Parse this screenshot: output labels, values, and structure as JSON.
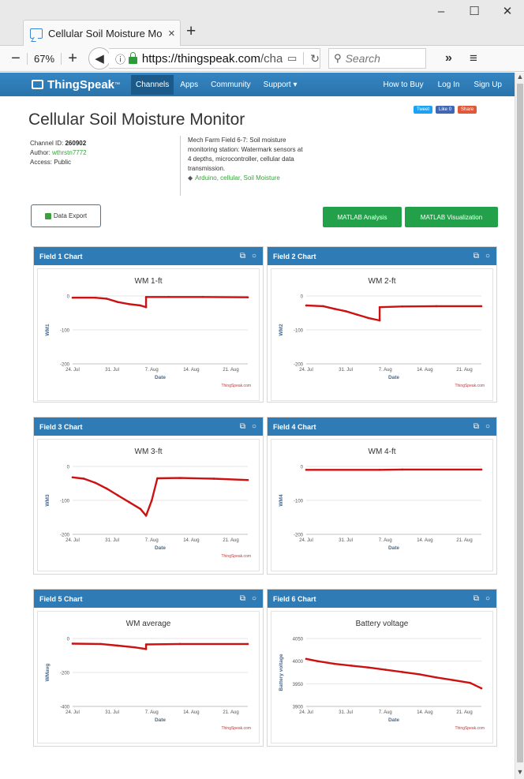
{
  "browser": {
    "tab_title": "Cellular Soil Moisture Mo",
    "tab_close": "×",
    "new_tab": "+",
    "window_minimize": "–",
    "window_maximize": "☐",
    "window_close": "✕",
    "zoom_minus": "−",
    "zoom_level": "67%",
    "zoom_plus": "+",
    "url_host": "https://thingspeak.com",
    "url_path": "/cha",
    "search_placeholder": "Search",
    "overflow_glyph": "»",
    "menu_glyph": "≡"
  },
  "site_nav": {
    "logo": "ThingSpeak",
    "logo_tm": "™",
    "items": [
      "Channels",
      "Apps",
      "Community",
      "Support ▾"
    ],
    "right_items": [
      "How to Buy",
      "Log In",
      "Sign Up"
    ]
  },
  "social": {
    "tweet": "Tweet",
    "like": "Like 0",
    "share": "Share"
  },
  "channel": {
    "title": "Cellular Soil Moisture Monitor",
    "id_label": "Channel ID:",
    "id_value": "260902",
    "author_label": "Author:",
    "author_value": "wthrstn7772",
    "access": "Access: Public",
    "description_lines": [
      "Mech Farm Field 6-7: Soil moisture",
      "monitoring station: Watermark sensors at",
      "4 depths, microcontroller, cellular data",
      "transmission."
    ],
    "tags": "Arduino, cellular, Soil Moisture"
  },
  "buttons": {
    "data_export": "Data Export",
    "matlab_analysis": "MATLAB Analysis",
    "matlab_visualization": "MATLAB Visualization"
  },
  "colors": {
    "nav_blue": "#2e7bb6",
    "series_red": "#cc1111",
    "button_green": "#22a14a",
    "link_green": "#37a33a"
  },
  "chart_data": [
    {
      "panel": "Field 1 Chart",
      "type": "line",
      "title": "WM 1-ft",
      "xlabel": "Date",
      "ylabel": "WM1",
      "credit": "ThingSpeak.com",
      "x_ticks": [
        "24. Jul",
        "31. Jul",
        "7. Aug",
        "14. Aug",
        "21. Aug"
      ],
      "xlim": [
        "2017-07-24",
        "2017-08-24"
      ],
      "y_ticks": [
        0,
        -100,
        -200
      ],
      "ylim": [
        -200,
        0
      ],
      "x": [
        "2017-07-24",
        "2017-07-28",
        "2017-07-30",
        "2017-08-01",
        "2017-08-03",
        "2017-08-05",
        "2017-08-06",
        "2017-08-06",
        "2017-08-10",
        "2017-08-16",
        "2017-08-24"
      ],
      "values": [
        -5,
        -5,
        -8,
        -18,
        -24,
        -28,
        -33,
        -3,
        -3,
        -3,
        -4
      ]
    },
    {
      "panel": "Field 2 Chart",
      "type": "line",
      "title": "WM 2-ft",
      "xlabel": "Date",
      "ylabel": "WM2",
      "credit": "ThingSpeak.com",
      "x_ticks": [
        "24. Jul",
        "31. Jul",
        "7. Aug",
        "14. Aug",
        "21. Aug"
      ],
      "xlim": [
        "2017-07-24",
        "2017-08-24"
      ],
      "y_ticks": [
        0,
        -100,
        -200
      ],
      "ylim": [
        -200,
        0
      ],
      "x": [
        "2017-07-24",
        "2017-07-27",
        "2017-07-29",
        "2017-07-31",
        "2017-08-02",
        "2017-08-04",
        "2017-08-06",
        "2017-08-06",
        "2017-08-10",
        "2017-08-16",
        "2017-08-24"
      ],
      "values": [
        -28,
        -30,
        -38,
        -45,
        -55,
        -65,
        -72,
        -33,
        -31,
        -30,
        -30
      ]
    },
    {
      "panel": "Field 3 Chart",
      "type": "line",
      "title": "WM 3-ft",
      "xlabel": "Date",
      "ylabel": "WM3",
      "credit": "ThingSpeak.com",
      "x_ticks": [
        "24. Jul",
        "31. Jul",
        "7. Aug",
        "14. Aug",
        "21. Aug"
      ],
      "xlim": [
        "2017-07-24",
        "2017-08-24"
      ],
      "y_ticks": [
        0,
        -100,
        -200
      ],
      "ylim": [
        -200,
        0
      ],
      "x": [
        "2017-07-24",
        "2017-07-26",
        "2017-07-28",
        "2017-07-30",
        "2017-08-01",
        "2017-08-03",
        "2017-08-05",
        "2017-08-06",
        "2017-08-07",
        "2017-08-08",
        "2017-08-12",
        "2017-08-18",
        "2017-08-24"
      ],
      "values": [
        -32,
        -36,
        -48,
        -65,
        -85,
        -105,
        -125,
        -145,
        -100,
        -35,
        -34,
        -36,
        -40
      ]
    },
    {
      "panel": "Field 4 Chart",
      "type": "line",
      "title": "WM 4-ft",
      "xlabel": "Date",
      "ylabel": "WM4",
      "credit": "",
      "x_ticks": [
        "24. Jul",
        "31. Jul",
        "7. Aug",
        "14. Aug",
        "21. Aug"
      ],
      "xlim": [
        "2017-07-24",
        "2017-08-24"
      ],
      "y_ticks": [
        0,
        -100,
        -200
      ],
      "ylim": [
        -200,
        0
      ],
      "x": [
        "2017-07-24",
        "2017-08-06",
        "2017-08-10",
        "2017-08-24"
      ],
      "values": [
        -10,
        -10,
        -9,
        -9
      ]
    },
    {
      "panel": "Field 5 Chart",
      "type": "line",
      "title": "WM average",
      "xlabel": "Date",
      "ylabel": "WMavg",
      "credit": "ThingSpeak.com",
      "x_ticks": [
        "24. Jul",
        "31. Jul",
        "7. Aug",
        "14. Aug",
        "21. Aug"
      ],
      "xlim": [
        "2017-07-24",
        "2017-08-24"
      ],
      "y_ticks": [
        0,
        -200,
        -400
      ],
      "ylim": [
        -400,
        0
      ],
      "x": [
        "2017-07-24",
        "2017-07-29",
        "2017-08-01",
        "2017-08-04",
        "2017-08-06",
        "2017-08-06",
        "2017-08-12",
        "2017-08-24"
      ],
      "values": [
        -30,
        -32,
        -42,
        -52,
        -62,
        -35,
        -32,
        -32
      ]
    },
    {
      "panel": "Field 6 Chart",
      "type": "line",
      "title": "Battery voltage",
      "xlabel": "Date",
      "ylabel": "Battery voltage",
      "credit": "ThingSpeak.com",
      "x_ticks": [
        "24. Jul",
        "31. Jul",
        "7. Aug",
        "14. Aug",
        "21. Aug"
      ],
      "xlim": [
        "2017-07-24",
        "2017-08-24"
      ],
      "y_ticks": [
        4050,
        4000,
        3950,
        3900
      ],
      "y_tick_labels": [
        "4050",
        "4000",
        "3950",
        "3900"
      ],
      "ylim": [
        3900,
        4050
      ],
      "x": [
        "2017-07-24",
        "2017-07-26",
        "2017-07-29",
        "2017-08-01",
        "2017-08-04",
        "2017-08-07",
        "2017-08-10",
        "2017-08-13",
        "2017-08-16",
        "2017-08-19",
        "2017-08-22",
        "2017-08-24"
      ],
      "values": [
        4005,
        4000,
        3994,
        3990,
        3986,
        3981,
        3976,
        3971,
        3964,
        3958,
        3952,
        3940
      ]
    }
  ],
  "panel_icons": {
    "popout": "⧉",
    "comment": "○"
  }
}
